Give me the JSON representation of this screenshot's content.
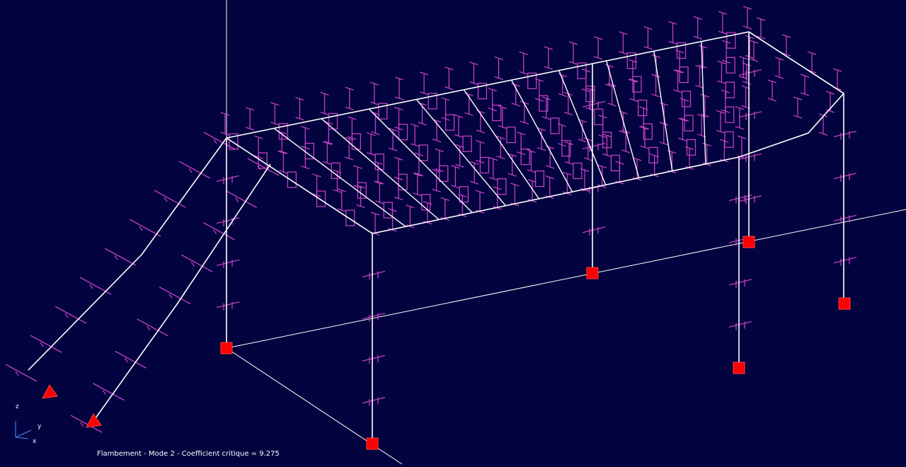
{
  "status": {
    "analysis": "Flambement",
    "mode": "Mode 2",
    "coefficient_label": "Coefficient critique",
    "coefficient_value": "9.275",
    "text": "Flambement - Mode 2 - Coefficient critique = 9.275"
  },
  "axes": {
    "z": "z",
    "y": "y",
    "x": "x"
  },
  "colors": {
    "background": "#03033f",
    "structure": "#ffffff",
    "mode_shape": "#c040c0",
    "supports": "#ff0000"
  }
}
